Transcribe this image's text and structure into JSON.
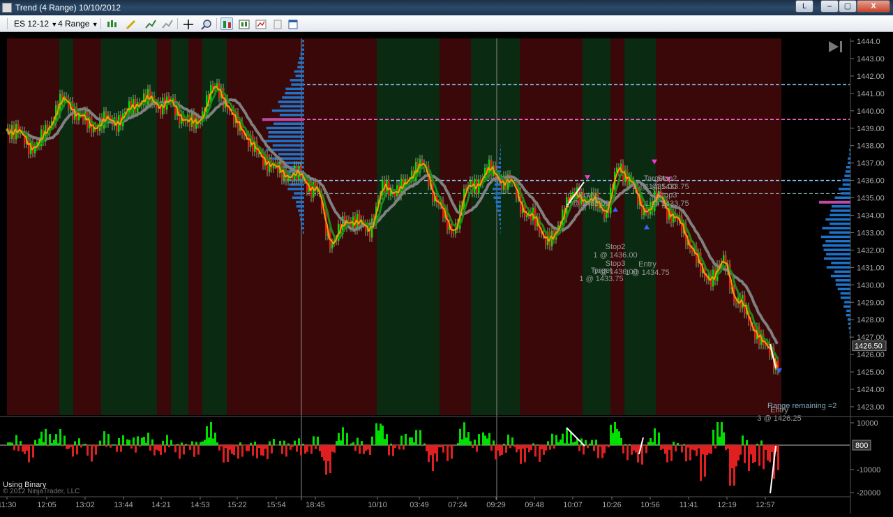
{
  "window": {
    "title": "Trend (4 Range)  10/10/2012",
    "buttons": [
      "L",
      "–",
      "▢",
      "X"
    ]
  },
  "toolbar": {
    "instrument": "ES 12-12",
    "period": "4 Range"
  },
  "chart": {
    "price_ticks": [
      "1444.0",
      "1443.00",
      "1442.00",
      "1441.00",
      "1440.00",
      "1439.00",
      "1438.00",
      "1437.00",
      "1436.00",
      "1435.00",
      "1434.00",
      "1433.00",
      "1432.00",
      "1431.00",
      "1430.00",
      "1429.00",
      "1428.00",
      "1427.00",
      "1426.00",
      "1425.00",
      "1424.00",
      "1423.00"
    ],
    "last_price": "1426.50",
    "range_remaining": "Range remaining =2",
    "time_ticks": [
      "11:30",
      "12:05",
      "13:02",
      "13:44",
      "14:21",
      "14:53",
      "15:22",
      "15:54",
      "18:45",
      "10/10",
      "03:49",
      "07:24",
      "09:29",
      "09:48",
      "10:07",
      "10:26",
      "10:56",
      "11:41",
      "12:19",
      "12:57"
    ],
    "indicator_ticks": [
      "10000",
      "-10000",
      "-20000"
    ],
    "indicator_value": "800",
    "indicator_label": "Using Binary",
    "copyright": "© 2012 NinjaTrader, LLC",
    "annotations": [
      {
        "lines": [
          "Entry",
          "3 @ 1435.00"
        ]
      },
      {
        "lines": [
          "Stop2",
          "1 @ 1436.00"
        ]
      },
      {
        "lines": [
          "Stop3",
          "1 @ 1436.00"
        ]
      },
      {
        "lines": [
          "Target",
          "1 @ 1433.75"
        ]
      },
      {
        "lines": [
          "Entry",
          "1 @ 1434.75"
        ]
      },
      {
        "lines": [
          "Target",
          "1 @ 1435.00"
        ]
      },
      {
        "lines": [
          "Stop2",
          "1 @ 1433.75"
        ]
      },
      {
        "lines": [
          "Stop3",
          "1 @ 1433.75"
        ]
      },
      {
        "lines": [
          "Entry",
          "3 @ 1426.25"
        ]
      }
    ],
    "colors": {
      "up_bar": "#00e000",
      "down_bar": "#e02020",
      "fast_ma": "#ff9900",
      "mid_ma": "#1a8a1a",
      "slow_ma": "#808080",
      "blue_line": "#8fd0ff",
      "magenta_line": "#ff66dd",
      "profile": "#1e73c8"
    }
  }
}
